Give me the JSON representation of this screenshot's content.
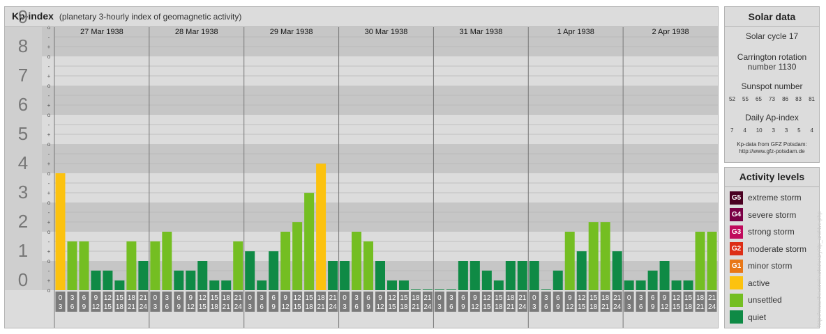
{
  "header": {
    "title": "Kp-index",
    "subtitle": "(planetary 3-hourly index of geomagnetic activity)"
  },
  "solar": {
    "title": "Solar data",
    "cycle_label": "Solar cycle 17",
    "rotation_label_1": "Carrington rotation",
    "rotation_label_2": "number 1130",
    "sunspot_title": "Sunspot number",
    "sunspot_values": [
      "52",
      "55",
      "65",
      "73",
      "86",
      "83",
      "81"
    ],
    "ap_title": "Daily Ap-index",
    "ap_values": [
      "7",
      "4",
      "10",
      "3",
      "3",
      "5",
      "4"
    ],
    "source_1": "Kp-data from GFZ Potsdam:",
    "source_2": "http://www.gfz-potsdam.de"
  },
  "activity": {
    "title": "Activity levels",
    "items": [
      {
        "badge": "G5",
        "label": "extreme storm",
        "color": "#4a0021"
      },
      {
        "badge": "G4",
        "label": "severe storm",
        "color": "#7a0045"
      },
      {
        "badge": "G3",
        "label": "strong storm",
        "color": "#c00a5c"
      },
      {
        "badge": "G2",
        "label": "moderate storm",
        "color": "#dd2e16"
      },
      {
        "badge": "G1",
        "label": "minor storm",
        "color": "#e87717"
      },
      {
        "badge": "",
        "label": "active",
        "color": "#fcc20f"
      },
      {
        "badge": "",
        "label": "unsettled",
        "color": "#74be22"
      },
      {
        "badge": "",
        "label": "quiet",
        "color": "#0f8a45"
      }
    ]
  },
  "watermark": "http://www.theusnclearbulurary/dp_archive.php",
  "chart_data": {
    "type": "bar",
    "y_axis_labels": [
      "0",
      "1",
      "2",
      "3",
      "4",
      "5",
      "6",
      "7",
      "8",
      "9"
    ],
    "y_minor_symbols": [
      "o",
      "+",
      "-"
    ],
    "ylim": [
      0,
      9
    ],
    "days": [
      "27 Mar 1938",
      "28 Mar 1938",
      "29 Mar 1938",
      "30 Mar 1938",
      "31 Mar 1938",
      "1 Apr 1938",
      "2 Apr 1938"
    ],
    "interval_labels": [
      [
        "0",
        "3"
      ],
      [
        "3",
        "6"
      ],
      [
        "6",
        "9"
      ],
      [
        "9",
        "12"
      ],
      [
        "12",
        "15"
      ],
      [
        "15",
        "18"
      ],
      [
        "18",
        "21"
      ],
      [
        "21",
        "24"
      ]
    ],
    "values": [
      4.0,
      1.67,
      1.67,
      0.67,
      0.67,
      0.33,
      1.67,
      1.0,
      1.67,
      2.0,
      0.67,
      0.67,
      1.0,
      0.33,
      0.33,
      1.67,
      1.33,
      0.33,
      1.33,
      2.0,
      2.33,
      3.33,
      4.33,
      1.0,
      1.0,
      2.0,
      1.67,
      1.0,
      0.33,
      0.33,
      0.0,
      0.0,
      0.0,
      0.0,
      1.0,
      1.0,
      0.67,
      0.33,
      1.0,
      1.0,
      1.0,
      0.0,
      0.67,
      2.0,
      1.33,
      2.33,
      2.33,
      1.33,
      0.33,
      0.33,
      0.67,
      1.0,
      0.33,
      0.33,
      2.0,
      2.0
    ],
    "level_colors": {
      "quiet": "#0f8a45",
      "unsettled": "#74be22",
      "active": "#fcc20f"
    },
    "grid": true
  }
}
